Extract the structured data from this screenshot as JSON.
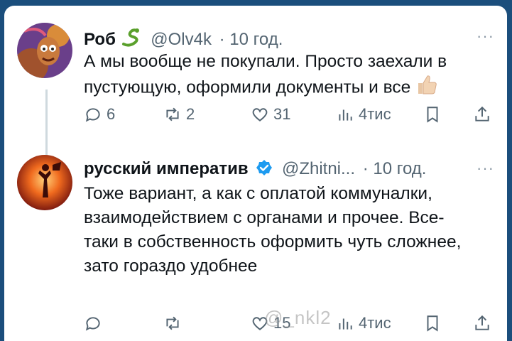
{
  "tweets": [
    {
      "name": "Роб",
      "handle": "@Olv4k",
      "time": "· 10 год.",
      "text": "А мы вообще не покупали. Просто заехали в пустующую, оформили документы и все",
      "emoji_icon": "thumbs-up-icon",
      "actions": {
        "replies": "6",
        "reposts": "2",
        "likes": "31",
        "views": "4тис"
      }
    },
    {
      "name": "русский императив",
      "handle": "@Zhitni...",
      "time": "· 10 год.",
      "text": "Тоже вариант, а как с оплатой коммуналки, взаимодействием с органами и прочее. Все-таки в собственность оформить чуть сложнее, зато гораздо удобнее",
      "actions": {
        "replies": "",
        "reposts": "",
        "likes": "15",
        "views": "4тис"
      }
    }
  ],
  "more_label": "···",
  "watermark": "@_nkl2",
  "colors": {
    "background": "#1b4e7c",
    "verified": "#1d9bf0",
    "muted": "#536471"
  }
}
